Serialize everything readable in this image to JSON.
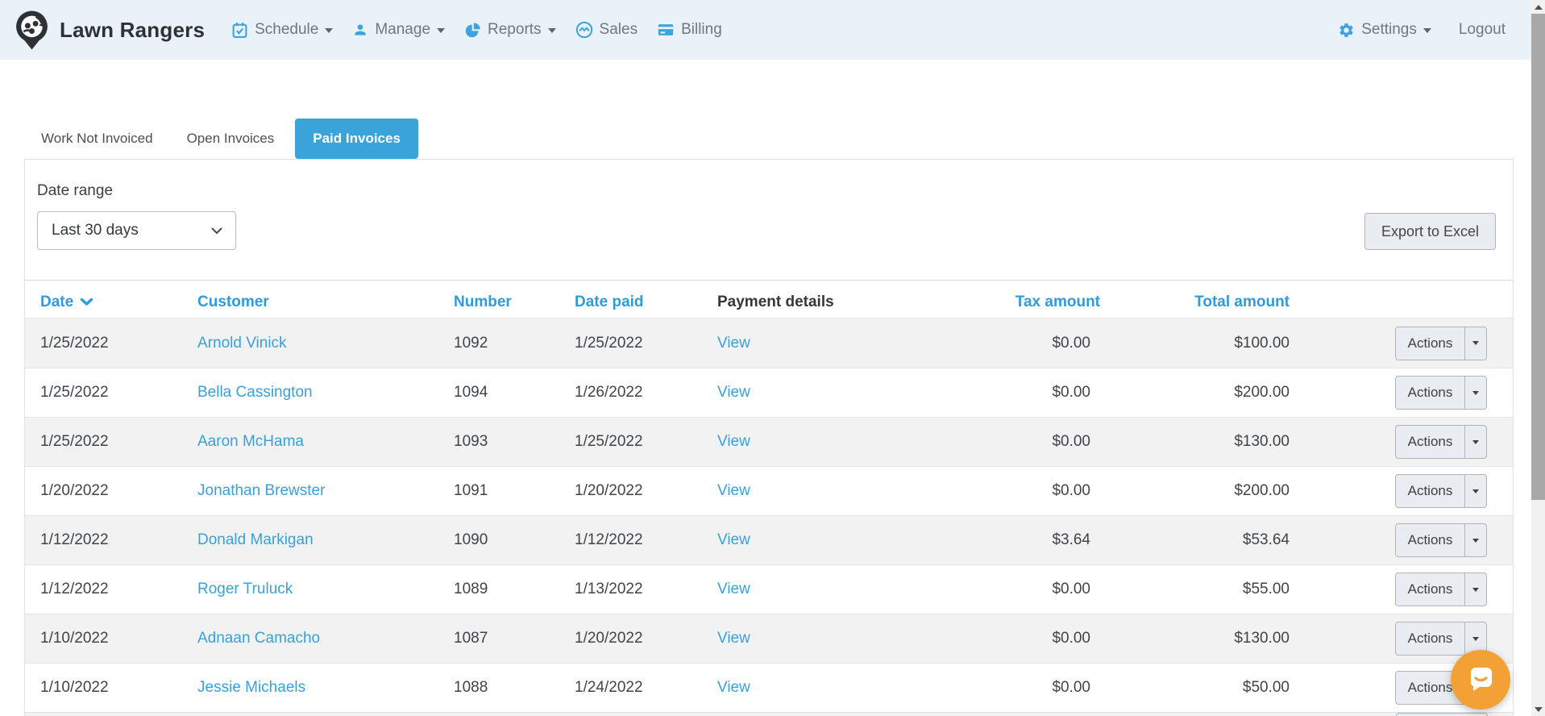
{
  "brand": {
    "name": "Lawn Rangers"
  },
  "nav": {
    "schedule": "Schedule",
    "manage": "Manage",
    "reports": "Reports",
    "sales": "Sales",
    "billing": "Billing",
    "settings": "Settings",
    "logout": "Logout"
  },
  "tabs": {
    "work_not_invoiced": "Work Not Invoiced",
    "open_invoices": "Open Invoices",
    "paid_invoices": "Paid Invoices"
  },
  "filters": {
    "date_range_label": "Date range",
    "date_range_value": "Last 30 days",
    "export_button": "Export to Excel"
  },
  "table": {
    "headers": {
      "date": "Date",
      "customer": "Customer",
      "number": "Number",
      "date_paid": "Date paid",
      "payment_details": "Payment details",
      "tax_amount": "Tax amount",
      "total_amount": "Total amount"
    },
    "actions_label": "Actions",
    "rows": [
      {
        "date": "1/25/2022",
        "customer": "Arnold Vinick",
        "number": "1092",
        "date_paid": "1/25/2022",
        "payment_details": "View",
        "tax_amount": "$0.00",
        "total_amount": "$100.00"
      },
      {
        "date": "1/25/2022",
        "customer": "Bella Cassington",
        "number": "1094",
        "date_paid": "1/26/2022",
        "payment_details": "View",
        "tax_amount": "$0.00",
        "total_amount": "$200.00"
      },
      {
        "date": "1/25/2022",
        "customer": "Aaron McHama",
        "number": "1093",
        "date_paid": "1/25/2022",
        "payment_details": "View",
        "tax_amount": "$0.00",
        "total_amount": "$130.00"
      },
      {
        "date": "1/20/2022",
        "customer": "Jonathan Brewster",
        "number": "1091",
        "date_paid": "1/20/2022",
        "payment_details": "View",
        "tax_amount": "$0.00",
        "total_amount": "$200.00"
      },
      {
        "date": "1/12/2022",
        "customer": "Donald Markigan",
        "number": "1090",
        "date_paid": "1/12/2022",
        "payment_details": "View",
        "tax_amount": "$3.64",
        "total_amount": "$53.64"
      },
      {
        "date": "1/12/2022",
        "customer": "Roger Truluck",
        "number": "1089",
        "date_paid": "1/13/2022",
        "payment_details": "View",
        "tax_amount": "$0.00",
        "total_amount": "$55.00"
      },
      {
        "date": "1/10/2022",
        "customer": "Adnaan Camacho",
        "number": "1087",
        "date_paid": "1/20/2022",
        "payment_details": "View",
        "tax_amount": "$0.00",
        "total_amount": "$130.00"
      },
      {
        "date": "1/10/2022",
        "customer": "Jessie Michaels",
        "number": "1088",
        "date_paid": "1/24/2022",
        "payment_details": "View",
        "tax_amount": "$0.00",
        "total_amount": "$50.00"
      }
    ]
  },
  "icons": {
    "logo": "lawn-rangers-pin-logo",
    "schedule": "calendar-icon",
    "manage": "user-icon",
    "reports": "pie-chart-icon",
    "sales": "handshake-icon",
    "billing": "credit-card-icon",
    "settings": "gear-icon",
    "sort": "chevron-down-icon",
    "chat": "chat-bubble-icon"
  },
  "colors": {
    "navbar_bg": "#e9f2f8",
    "accent_blue": "#2d9cdb",
    "tab_active_bg": "#39a3da",
    "link": "#3aa0d8",
    "row_alt_bg": "#f2f2f2",
    "button_bg": "#e9edf1",
    "chat_bubble": "#f2a134"
  }
}
